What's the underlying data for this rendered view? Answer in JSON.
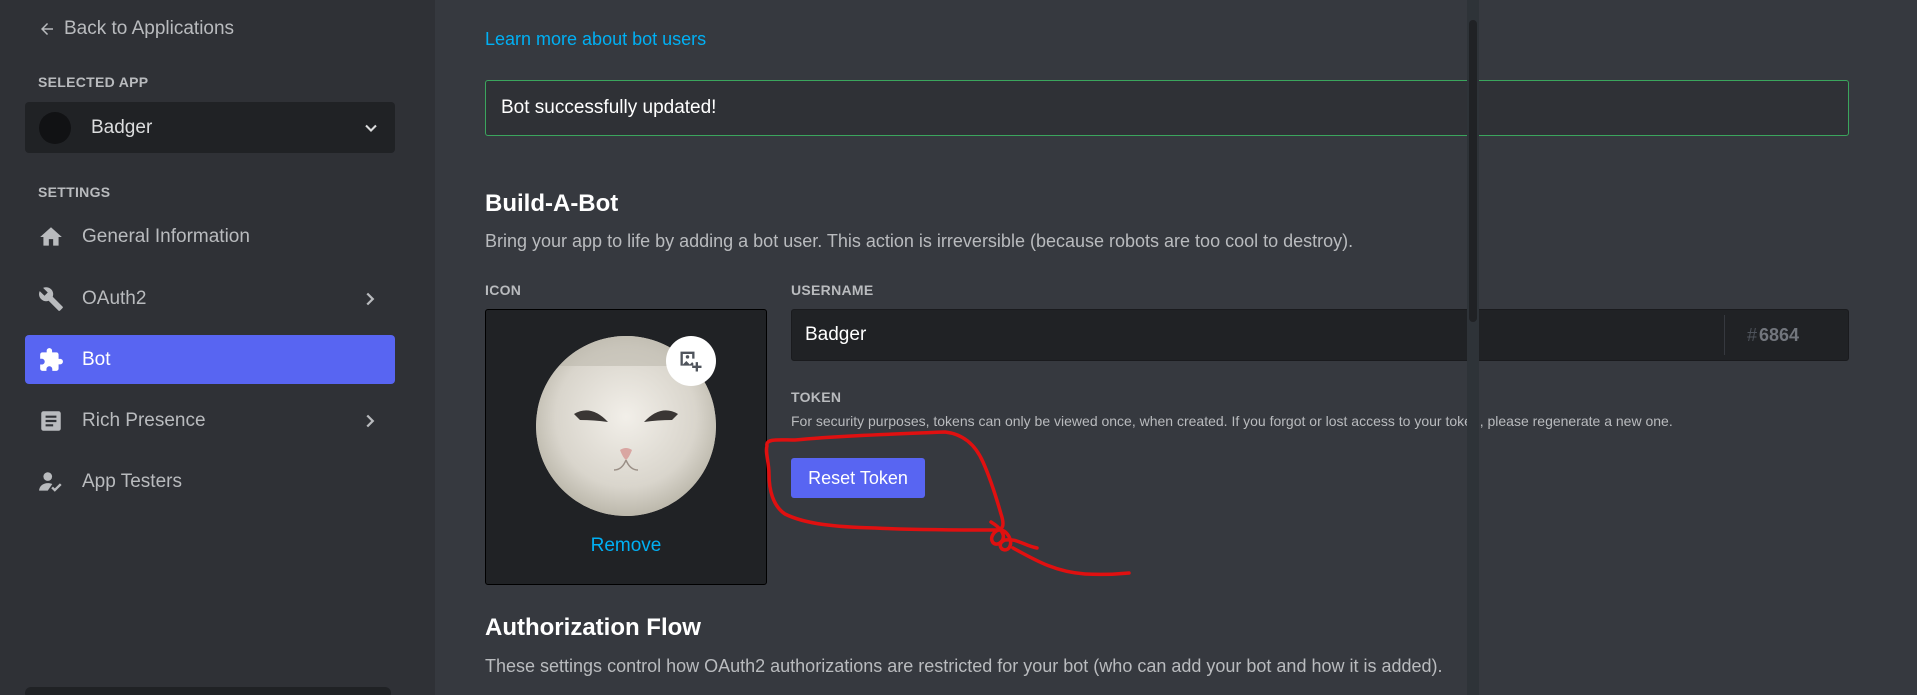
{
  "sidebar": {
    "back_label": "Back to Applications",
    "selected_app_label": "SELECTED APP",
    "app_name": "Badger",
    "settings_label": "SETTINGS",
    "items": [
      {
        "label": "General Information",
        "icon": "home-icon"
      },
      {
        "label": "OAuth2",
        "icon": "wrench-icon",
        "expandable": true
      },
      {
        "label": "Bot",
        "icon": "puzzle-icon",
        "active": true
      },
      {
        "label": "Rich Presence",
        "icon": "document-icon",
        "expandable": true
      },
      {
        "label": "App Testers",
        "icon": "user-icon"
      }
    ]
  },
  "main": {
    "learn_link": "Learn more about bot users",
    "success_message": "Bot successfully updated!",
    "build_title": "Build-A-Bot",
    "build_desc": "Bring your app to life by adding a bot user. This action is irreversible (because robots are too cool to destroy).",
    "icon_label": "ICON",
    "remove_label": "Remove",
    "username_label": "USERNAME",
    "username_value": "Badger",
    "discriminator": "6864",
    "token_label": "TOKEN",
    "token_note": "For security purposes, tokens can only be viewed once, when created. If you forgot or lost access to your token, please regenerate a new one.",
    "reset_token_label": "Reset Token",
    "auth_title": "Authorization Flow",
    "auth_desc": "These settings control how OAuth2 authorizations are restricted for your bot (who can add your bot and how it is added)."
  },
  "colors": {
    "accent": "#5865f2",
    "link": "#00b0f4",
    "success": "#3ba55d",
    "annotation": "#e01010"
  }
}
